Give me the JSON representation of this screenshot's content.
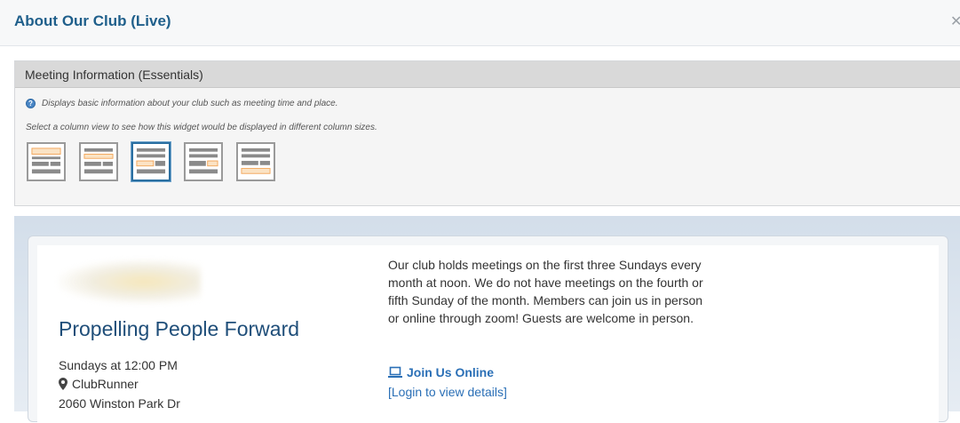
{
  "window": {
    "title": "About Our Club (Live)",
    "close_icon": "close-icon"
  },
  "widget": {
    "header": "Meeting Information (Essentials)",
    "info_text": "Displays basic information about your club such as meeting time and place.",
    "info_icon": "question-icon",
    "select_text": "Select a column view to see how this widget would be displayed in different column sizes.",
    "layouts": [
      {
        "name": "full-width",
        "selected": false
      },
      {
        "name": "two-thirds-left",
        "selected": false
      },
      {
        "name": "two-column-center",
        "selected": true
      },
      {
        "name": "two-thirds-right",
        "selected": false
      },
      {
        "name": "bottom-highlight",
        "selected": false
      }
    ]
  },
  "preview": {
    "club_title": "Propelling People Forward",
    "meeting_time": "Sundays at 12:00 PM",
    "venue": "ClubRunner",
    "venue_icon": "map-pin-icon",
    "address": "2060 Winston Park Dr",
    "description": "Our club holds meetings on the first three Sundays every month at noon. We do not have meetings on the fourth or fifth Sunday of the month. Members can join us in person or online through zoom! Guests are welcome in person.",
    "join_label": "Join Us Online",
    "join_icon": "laptop-icon",
    "login_label": "[Login to view details]"
  },
  "colors": {
    "title_blue": "#1f5f8b",
    "link_blue": "#2a6fb6",
    "highlight_orange": "#f7c48a",
    "selected_border": "#2a6fa1"
  }
}
